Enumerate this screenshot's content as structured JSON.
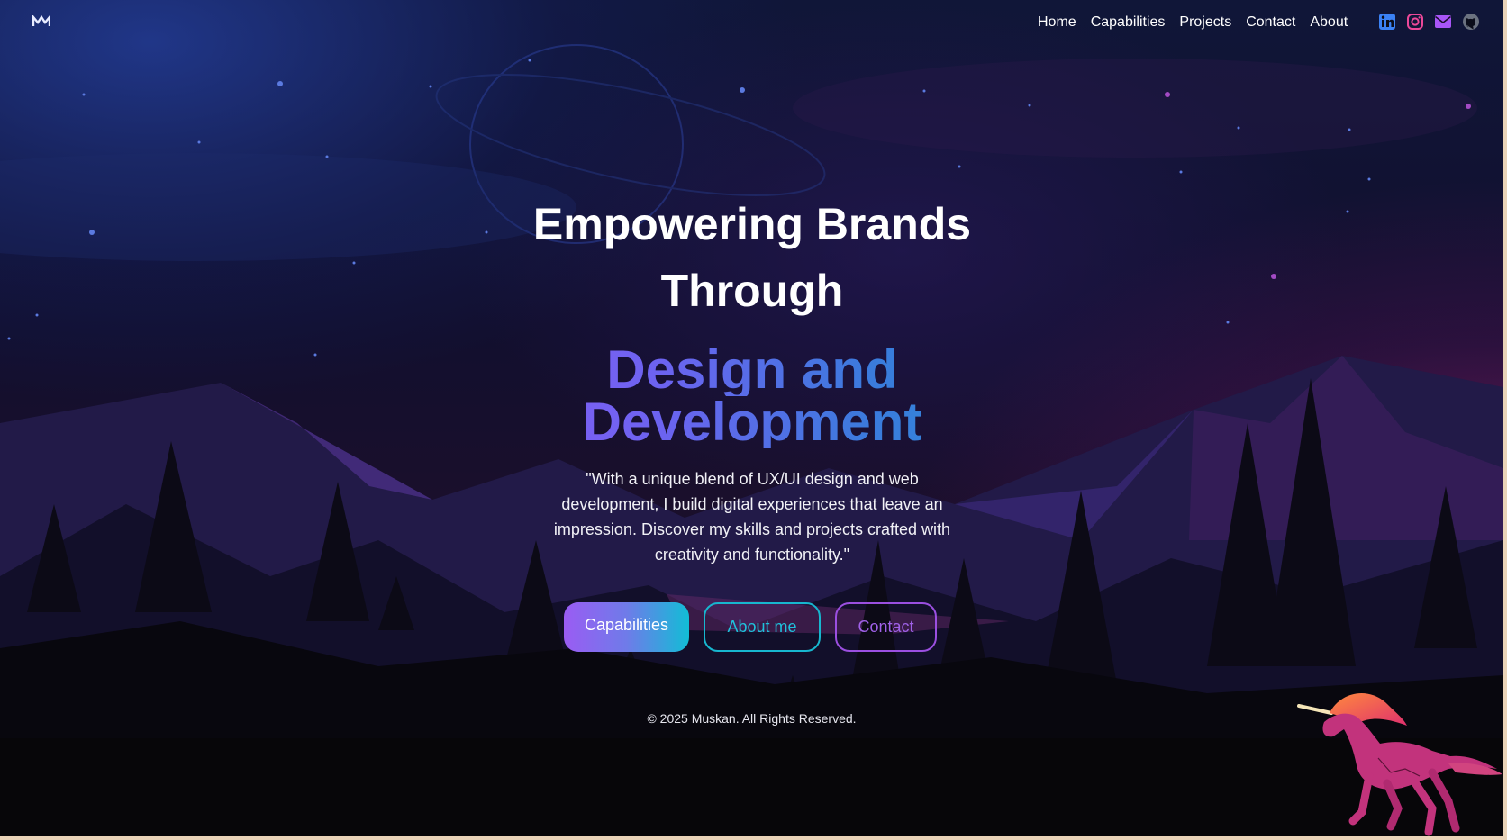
{
  "brand": {
    "logo_icon": "mn-monogram-logo-icon"
  },
  "nav": {
    "items": [
      {
        "label": "Home"
      },
      {
        "label": "Capabilities"
      },
      {
        "label": "Projects"
      },
      {
        "label": "Contact"
      },
      {
        "label": "About"
      }
    ]
  },
  "social": [
    {
      "icon": "linkedin-icon",
      "color": "#3b82f6"
    },
    {
      "icon": "instagram-icon",
      "color": "#ec4899"
    },
    {
      "icon": "mail-icon",
      "color": "#a855f7"
    },
    {
      "icon": "github-icon",
      "color": "#6b7280"
    }
  ],
  "hero": {
    "title_line1": "Empowering Brands",
    "title_line2": "Through",
    "highlight_line1": "Design and",
    "highlight_line2": "Development",
    "tagline": "\"With a unique blend of UX/UI design and web development, I build digital experiences that leave an impression. Discover my skills and projects crafted with creativity and functionality.\""
  },
  "buttons": {
    "capabilities_label": "Capabilities",
    "about_label": "About me",
    "contact_label": "Contact"
  },
  "footer": {
    "text": "© 2025 Muskan. All Rights Reserved."
  },
  "colors": {
    "accent_purple": "#9a5cf3",
    "accent_cyan": "#12bdd6",
    "background": "#0a0c18"
  }
}
